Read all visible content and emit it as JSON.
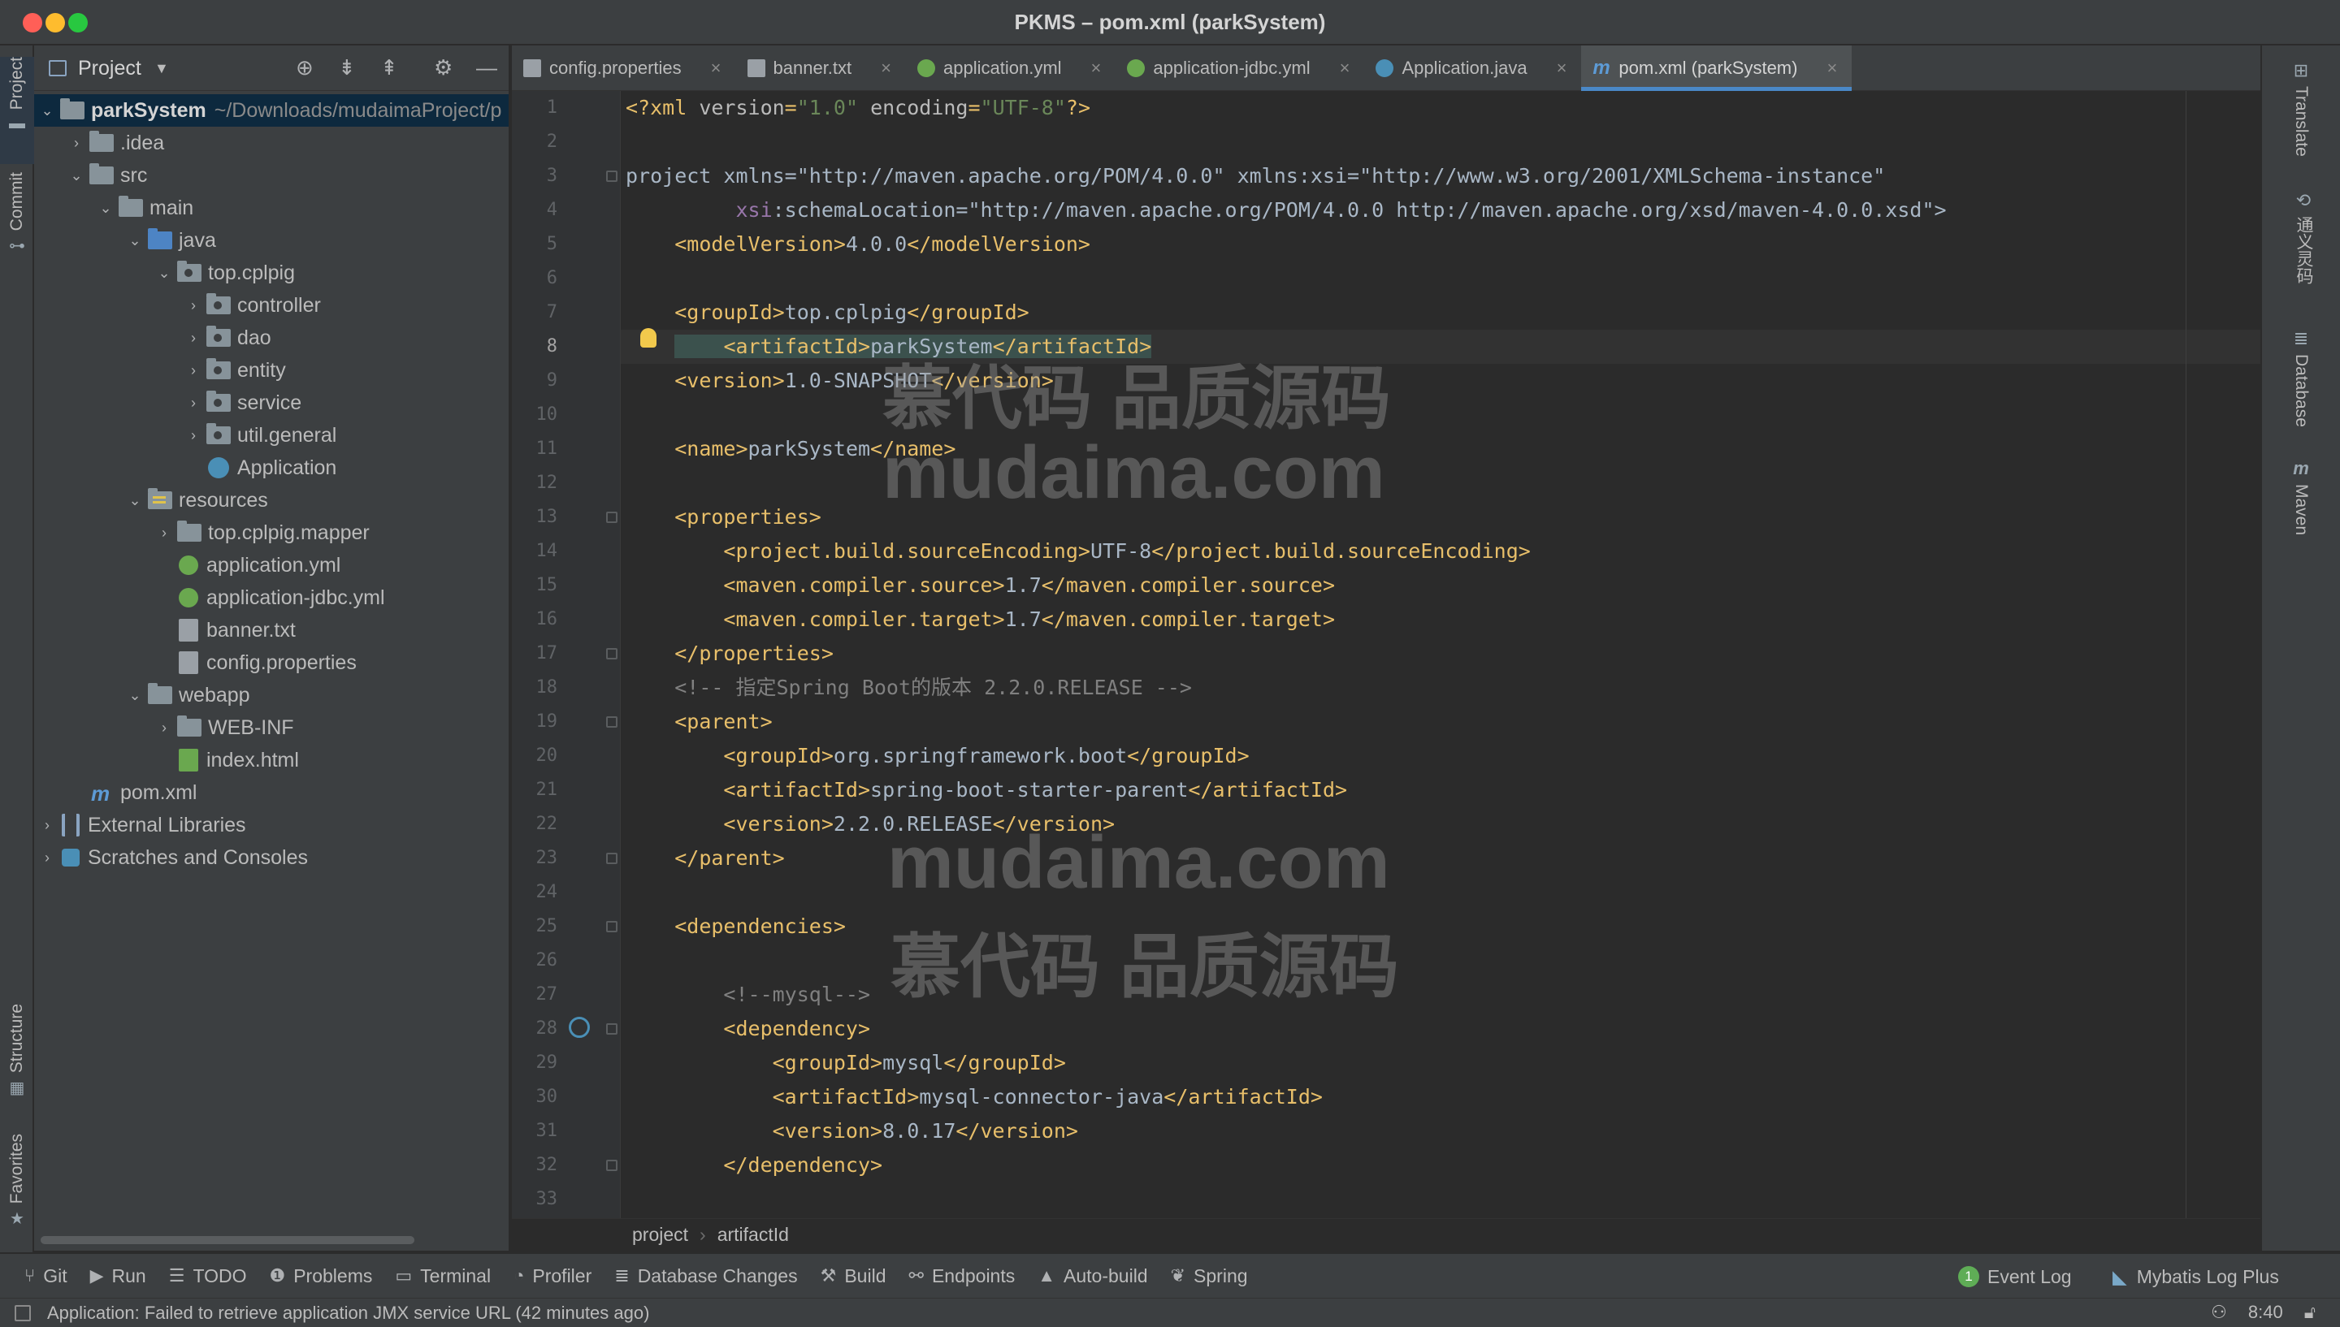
{
  "window": {
    "title": "PKMS – pom.xml (parkSystem)"
  },
  "left_strip": [
    "Project",
    "Commit",
    "Structure",
    "Favorites"
  ],
  "project_panel": {
    "title": "Project",
    "tree": [
      {
        "label": "parkSystem",
        "path": "~/Downloads/mudaimaProject/p",
        "depth": 0,
        "icon": "project",
        "expanded": true,
        "selected": true,
        "bold": true
      },
      {
        "label": ".idea",
        "depth": 1,
        "icon": "folder",
        "expanded": false
      },
      {
        "label": "src",
        "depth": 1,
        "icon": "folder",
        "expanded": true
      },
      {
        "label": "main",
        "depth": 2,
        "icon": "folder",
        "expanded": true
      },
      {
        "label": "java",
        "depth": 3,
        "icon": "folder-blue",
        "expanded": true
      },
      {
        "label": "top.cplpig",
        "depth": 4,
        "icon": "package",
        "expanded": true
      },
      {
        "label": "controller",
        "depth": 5,
        "icon": "package",
        "expanded": false
      },
      {
        "label": "dao",
        "depth": 5,
        "icon": "package",
        "expanded": false
      },
      {
        "label": "entity",
        "depth": 5,
        "icon": "package",
        "expanded": false
      },
      {
        "label": "service",
        "depth": 5,
        "icon": "package",
        "expanded": false
      },
      {
        "label": "util.general",
        "depth": 5,
        "icon": "package",
        "expanded": false
      },
      {
        "label": "Application",
        "depth": 5,
        "icon": "java"
      },
      {
        "label": "resources",
        "depth": 3,
        "icon": "resources",
        "expanded": true
      },
      {
        "label": "top.cplpig.mapper",
        "depth": 4,
        "icon": "folder",
        "expanded": false
      },
      {
        "label": "application.yml",
        "depth": 4,
        "icon": "yml"
      },
      {
        "label": "application-jdbc.yml",
        "depth": 4,
        "icon": "yml"
      },
      {
        "label": "banner.txt",
        "depth": 4,
        "icon": "txt"
      },
      {
        "label": "config.properties",
        "depth": 4,
        "icon": "properties"
      },
      {
        "label": "webapp",
        "depth": 3,
        "icon": "folder",
        "expanded": true
      },
      {
        "label": "WEB-INF",
        "depth": 4,
        "icon": "folder",
        "expanded": false
      },
      {
        "label": "index.html",
        "depth": 4,
        "icon": "html"
      },
      {
        "label": "pom.xml",
        "depth": 1,
        "icon": "maven"
      },
      {
        "label": "External Libraries",
        "depth": 0,
        "icon": "library",
        "expanded": false
      },
      {
        "label": "Scratches and Consoles",
        "depth": 0,
        "icon": "scratch",
        "expanded": false
      }
    ]
  },
  "tabs": [
    {
      "label": "config.properties",
      "icon": "properties",
      "active": false
    },
    {
      "label": "banner.txt",
      "icon": "txt",
      "active": false
    },
    {
      "label": "application.yml",
      "icon": "yml",
      "active": false
    },
    {
      "label": "application-jdbc.yml",
      "icon": "yml",
      "active": false
    },
    {
      "label": "Application.java",
      "icon": "java",
      "active": false
    },
    {
      "label": "pom.xml (parkSystem)",
      "icon": "maven",
      "active": true
    }
  ],
  "editor": {
    "current_line": 8,
    "lines": [
      "<?xml version=\"1.0\" encoding=\"UTF-8\"?>",
      "",
      "<project xmlns=\"http://maven.apache.org/POM/4.0.0\" xmlns:xsi=\"http://www.w3.org/2001/XMLSchema-instance\"",
      "         xsi:schemaLocation=\"http://maven.apache.org/POM/4.0.0 http://maven.apache.org/xsd/maven-4.0.0.xsd\">",
      "    <modelVersion>4.0.0</modelVersion>",
      "",
      "    <groupId>top.cplpig</groupId>",
      "    <artifactId>parkSystem</artifactId>",
      "    <version>1.0-SNAPSHOT</version>",
      "",
      "    <name>parkSystem</name>",
      "",
      "    <properties>",
      "        <project.build.sourceEncoding>UTF-8</project.build.sourceEncoding>",
      "        <maven.compiler.source>1.7</maven.compiler.source>",
      "        <maven.compiler.target>1.7</maven.compiler.target>",
      "    </properties>",
      "    <!-- 指定Spring Boot的版本 2.2.0.RELEASE -->",
      "    <parent>",
      "        <groupId>org.springframework.boot</groupId>",
      "        <artifactId>spring-boot-starter-parent</artifactId>",
      "        <version>2.2.0.RELEASE</version>",
      "    </parent>",
      "",
      "    <dependencies>",
      "",
      "        <!--mysql-->",
      "        <dependency>",
      "            <groupId>mysql</groupId>",
      "            <artifactId>mysql-connector-java</artifactId>",
      "            <version>8.0.17</version>",
      "        </dependency>",
      ""
    ]
  },
  "watermarks": [
    "慕代码 品质源码",
    "mudaima.com",
    "mudaima.com",
    "慕代码 品质源码"
  ],
  "breadcrumb": [
    "project",
    "artifactId"
  ],
  "right_strip": [
    "Translate",
    "通义灵码",
    "Database",
    "Maven"
  ],
  "bottom_tools": [
    {
      "label": "Git",
      "icon": "git-icon"
    },
    {
      "label": "Run",
      "icon": "run-icon"
    },
    {
      "label": "TODO",
      "icon": "todo-icon"
    },
    {
      "label": "Problems",
      "icon": "problems-icon"
    },
    {
      "label": "Terminal",
      "icon": "terminal-icon"
    },
    {
      "label": "Profiler",
      "icon": "profiler-icon"
    },
    {
      "label": "Database Changes",
      "icon": "database-changes-icon"
    },
    {
      "label": "Build",
      "icon": "build-icon"
    },
    {
      "label": "Endpoints",
      "icon": "endpoints-icon"
    },
    {
      "label": "Auto-build",
      "icon": "auto-build-icon"
    },
    {
      "label": "Spring",
      "icon": "spring-icon"
    }
  ],
  "bottom_right": {
    "event_log": "Event Log",
    "event_log_count": "1",
    "mybatis": "Mybatis Log Plus"
  },
  "status": {
    "message": "Application: Failed to retrieve application JMX service URL (42 minutes ago)",
    "time": "8:40"
  },
  "colors": {
    "accent": "#4a88c7",
    "tag": "#e8bf6a",
    "string": "#6a8759",
    "comment": "#808080",
    "namespace": "#9876aa"
  }
}
